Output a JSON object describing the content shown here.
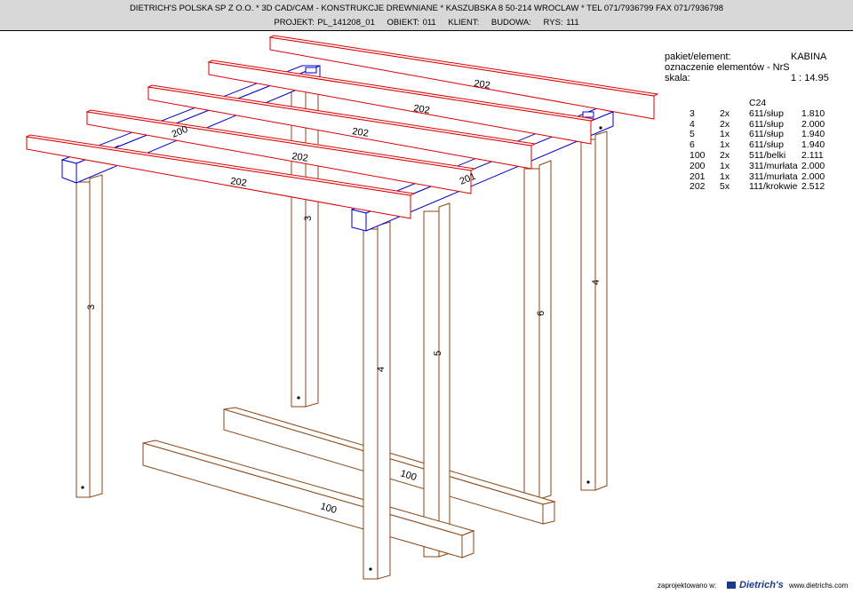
{
  "header": {
    "company": "DIETRICH'S POLSKA SP Z O.O. * 3D CAD/CAM - KONSTRUKCJE DREWNIANE * KASZUBSKA 8 50-214 WROCLAW * TEL 071/7936799 FAX 071/7936798",
    "projekt": "PROJEKT: PL_141208_01",
    "obiekt": "OBIEKT: 011",
    "klient": "KLIENT:",
    "budowa": "BUDOWA:",
    "rys": "RYS: 111"
  },
  "info": {
    "pakiet_label": "pakiet/element:",
    "pakiet_value": "KABINA",
    "oznaczenie": "oznaczenie elementów - NrS",
    "skala_label": "skala:",
    "skala_value": "1 : 14.95"
  },
  "table": {
    "material": "C24",
    "rows": [
      {
        "nr": "3",
        "qty": "2x",
        "profile": "611/słup",
        "length": "1.810"
      },
      {
        "nr": "4",
        "qty": "2x",
        "profile": "611/słup",
        "length": "2.000"
      },
      {
        "nr": "5",
        "qty": "1x",
        "profile": "611/słup",
        "length": "1.940"
      },
      {
        "nr": "6",
        "qty": "1x",
        "profile": "611/słup",
        "length": "1.940"
      },
      {
        "nr": "100",
        "qty": "2x",
        "profile": "511/belki",
        "length": "2.111"
      },
      {
        "nr": "200",
        "qty": "1x",
        "profile": "311/murłata",
        "length": "2.000"
      },
      {
        "nr": "201",
        "qty": "1x",
        "profile": "311/murłata",
        "length": "2.000"
      },
      {
        "nr": "202",
        "qty": "5x",
        "profile": "111/krokwie",
        "length": "2.512"
      }
    ]
  },
  "drawing": {
    "labels": {
      "rafter": "202",
      "plate_left": "200",
      "plate_front": "201",
      "beam": "100",
      "post_3": "3",
      "post_4": "4",
      "post_5": "5",
      "post_6": "6"
    },
    "colors": {
      "timber": "#8b4513",
      "rafter": "#dd0000",
      "plate": "#0000cc",
      "text": "#000000"
    }
  },
  "footer": {
    "designed_label": "zaprojektowano w:",
    "brand": "Dietrich's",
    "url": "www.dietrichs.com"
  }
}
